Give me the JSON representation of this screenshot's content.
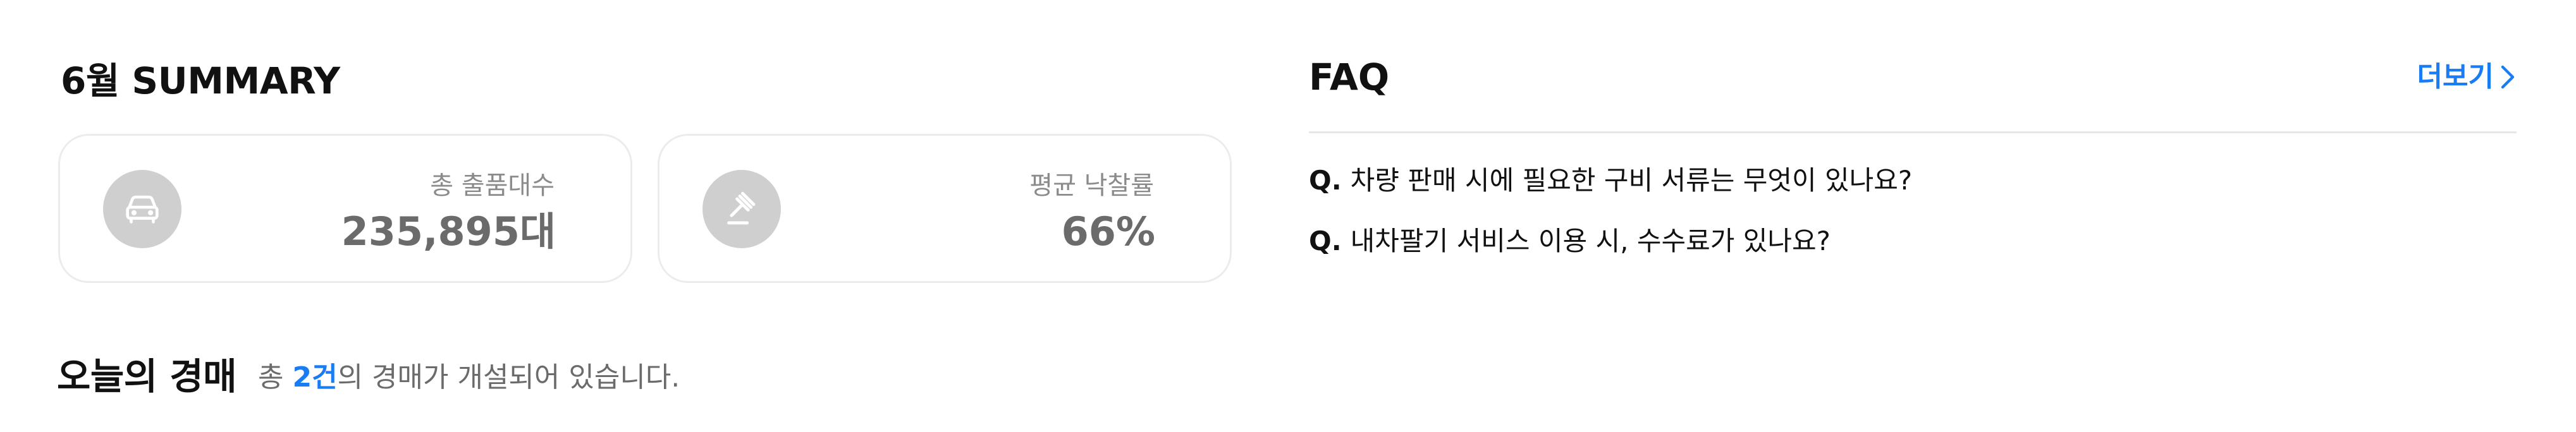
{
  "summary": {
    "title": "6월 SUMMARY",
    "stats": [
      {
        "label": "총 출품대수",
        "value": "235,895대",
        "icon": "car-icon"
      },
      {
        "label": "평균 낙찰률",
        "value": "66%",
        "icon": "gavel-icon"
      }
    ]
  },
  "today": {
    "title": "오늘의 경매",
    "prefix": "총 ",
    "count": "2건",
    "suffix": "의 경매가 개설되어 있습니다."
  },
  "faq": {
    "title": "FAQ",
    "more_label": "더보기",
    "items": [
      {
        "q": "Q.",
        "text": "차량 판매 시에 필요한 구비 서류는 무엇이 있나요?"
      },
      {
        "q": "Q.",
        "text": "내차팔기 서비스 이용 시, 수수료가 있나요?"
      }
    ]
  },
  "colors": {
    "accent": "#1a7cf3",
    "icon_bg": "#cfcfcf",
    "muted_text": "#6b6b6b"
  }
}
